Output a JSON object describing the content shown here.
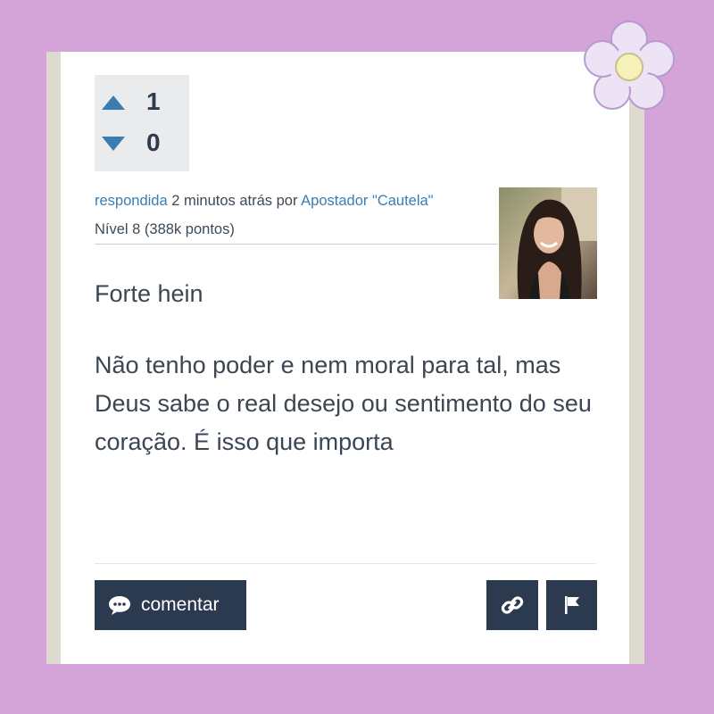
{
  "votes": {
    "up_count": "1",
    "down_count": "0"
  },
  "answer_meta": {
    "answered_link": "respondida",
    "time_text": " 2 minutos atrás por ",
    "author": "Apostador \"Cautela\"",
    "level": "Nível 8 (388k pontos)"
  },
  "answer_body": {
    "paragraph_1": "Forte hein",
    "paragraph_2": "Não tenho poder e nem moral para tal, mas Deus sabe o real desejo ou sentimento do seu coração. É isso que importa"
  },
  "actions": {
    "comment_label": "comentar"
  },
  "icons": {
    "upvote": "triangle-up-icon",
    "downvote": "triangle-down-icon",
    "comment": "speech-bubble-icon",
    "link": "chain-link-icon",
    "flag": "flag-icon",
    "decoration": "flower-sticker"
  },
  "colors": {
    "background": "#d4a3d8",
    "card": "#ffffff",
    "accent_link": "#3b7db0",
    "vote_arrow": "#3b7db0",
    "button": "#2b3a4e",
    "text": "#3b4653"
  }
}
